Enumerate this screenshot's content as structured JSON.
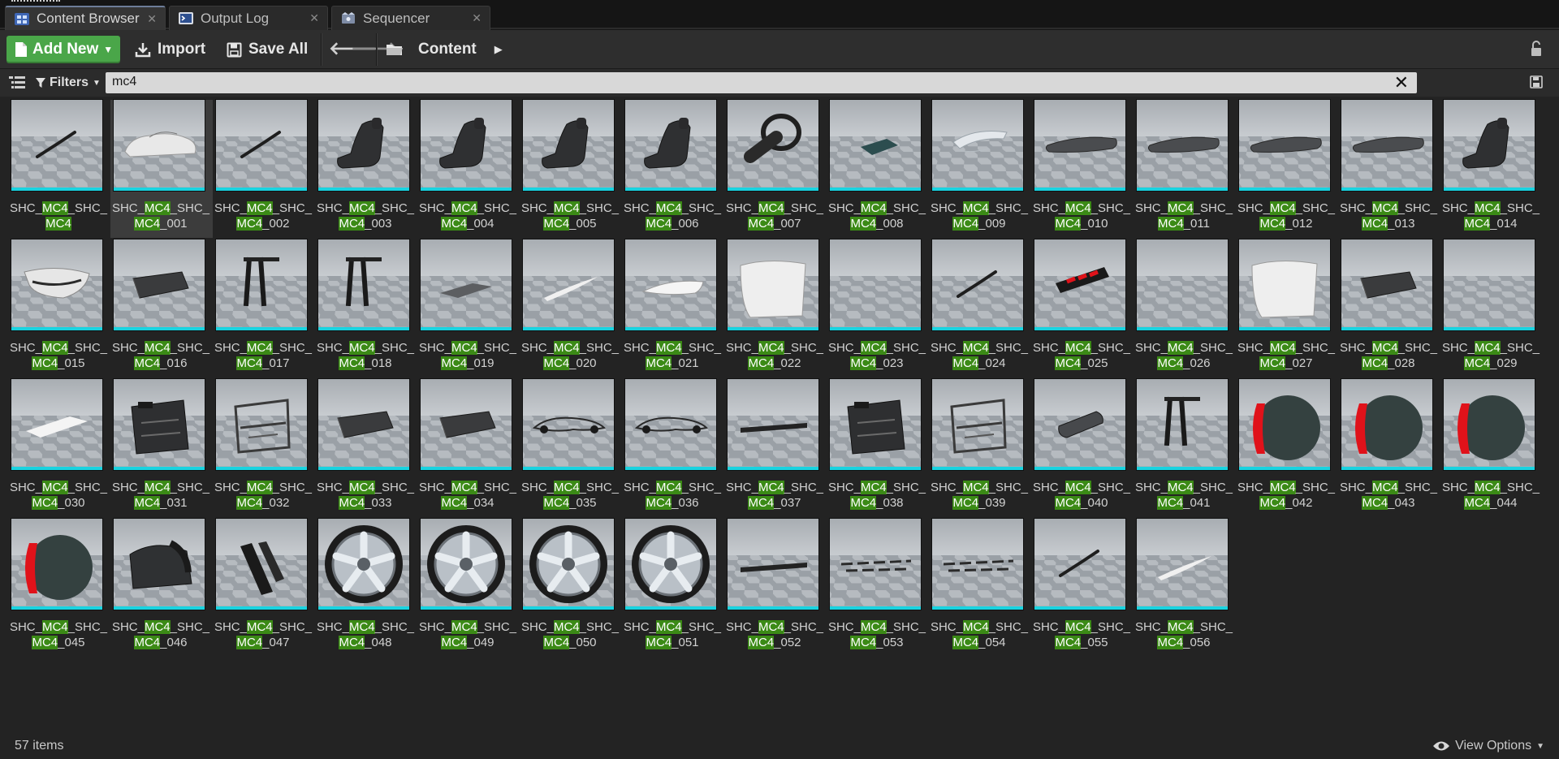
{
  "tabs": [
    {
      "label": "Content Browser",
      "icon": "content-browser-icon",
      "active": true
    },
    {
      "label": "Output Log",
      "icon": "output-log-icon",
      "active": false
    },
    {
      "label": "Sequencer",
      "icon": "sequencer-icon",
      "active": false
    }
  ],
  "toolbar": {
    "add_new_label": "Add New",
    "import_label": "Import",
    "save_all_label": "Save All",
    "path_label": "Content"
  },
  "search": {
    "filters_label": "Filters",
    "query": "mc4"
  },
  "assets": {
    "prefix": "SHC_",
    "highlight": "MC4",
    "middle": "_SHC_",
    "items": [
      {
        "suffix": "",
        "shape": "rod"
      },
      {
        "suffix": "_001",
        "shape": "car"
      },
      {
        "suffix": "_002",
        "shape": "rod"
      },
      {
        "suffix": "_003",
        "shape": "seat"
      },
      {
        "suffix": "_004",
        "shape": "seat"
      },
      {
        "suffix": "_005",
        "shape": "seat"
      },
      {
        "suffix": "_006",
        "shape": "seat"
      },
      {
        "suffix": "_007",
        "shape": "wheel-steer"
      },
      {
        "suffix": "_008",
        "shape": "plate-teal"
      },
      {
        "suffix": "_009",
        "shape": "glass"
      },
      {
        "suffix": "_010",
        "shape": "mat"
      },
      {
        "suffix": "_011",
        "shape": "mat"
      },
      {
        "suffix": "_012",
        "shape": "mat"
      },
      {
        "suffix": "_013",
        "shape": "mat"
      },
      {
        "suffix": "_014",
        "shape": "seat"
      },
      {
        "suffix": "_015",
        "shape": "bumper"
      },
      {
        "suffix": "_016",
        "shape": "block"
      },
      {
        "suffix": "_017",
        "shape": "pillar"
      },
      {
        "suffix": "_018",
        "shape": "pillar"
      },
      {
        "suffix": "_019",
        "shape": "plate-gray"
      },
      {
        "suffix": "_020",
        "shape": "blade"
      },
      {
        "suffix": "_021",
        "shape": "hood"
      },
      {
        "suffix": "_022",
        "shape": "door"
      },
      {
        "suffix": "_023",
        "shape": "empty"
      },
      {
        "suffix": "_024",
        "shape": "rod"
      },
      {
        "suffix": "_025",
        "shape": "taillight"
      },
      {
        "suffix": "_026",
        "shape": "empty"
      },
      {
        "suffix": "_027",
        "shape": "door"
      },
      {
        "suffix": "_028",
        "shape": "block"
      },
      {
        "suffix": "_029",
        "shape": "empty"
      },
      {
        "suffix": "_030",
        "shape": "plate-white"
      },
      {
        "suffix": "_031",
        "shape": "panel"
      },
      {
        "suffix": "_032",
        "shape": "frame"
      },
      {
        "suffix": "_033",
        "shape": "block"
      },
      {
        "suffix": "_034",
        "shape": "block"
      },
      {
        "suffix": "_035",
        "shape": "chassis"
      },
      {
        "suffix": "_036",
        "shape": "chassis"
      },
      {
        "suffix": "_037",
        "shape": "sill"
      },
      {
        "suffix": "_038",
        "shape": "panel"
      },
      {
        "suffix": "_039",
        "shape": "frame"
      },
      {
        "suffix": "_040",
        "shape": "mirror"
      },
      {
        "suffix": "_041",
        "shape": "pillar"
      },
      {
        "suffix": "_042",
        "shape": "disc-red"
      },
      {
        "suffix": "_043",
        "shape": "disc-red"
      },
      {
        "suffix": "_044",
        "shape": "disc-red"
      },
      {
        "suffix": "_045",
        "shape": "disc-red"
      },
      {
        "suffix": "_046",
        "shape": "arch"
      },
      {
        "suffix": "_047",
        "shape": "strips"
      },
      {
        "suffix": "_048",
        "shape": "rim"
      },
      {
        "suffix": "_049",
        "shape": "rim"
      },
      {
        "suffix": "_050",
        "shape": "rim"
      },
      {
        "suffix": "_051",
        "shape": "rim"
      },
      {
        "suffix": "_052",
        "shape": "sill"
      },
      {
        "suffix": "_053",
        "shape": "lines"
      },
      {
        "suffix": "_054",
        "shape": "lines"
      },
      {
        "suffix": "_055",
        "shape": "rod"
      },
      {
        "suffix": "_056",
        "shape": "blade"
      }
    ]
  },
  "status": {
    "item_count": "57 items",
    "view_options_label": "View Options"
  },
  "colors": {
    "accent_green": "#4aa649",
    "highlight_green": "#3b8a16",
    "thumb_bar": "#19d3e0",
    "caliper_red": "#e0121a"
  }
}
